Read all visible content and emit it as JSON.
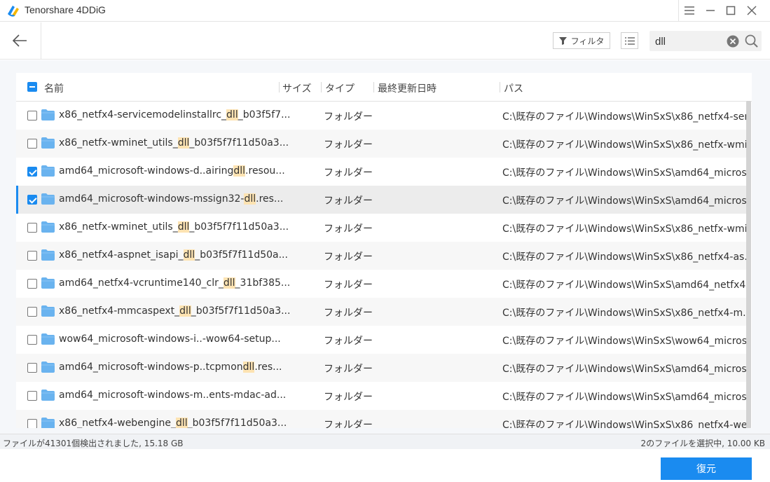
{
  "app": {
    "title": "Tenorshare 4DDiG"
  },
  "toolbar": {
    "filter_label": "フィルタ"
  },
  "search": {
    "value": "dll"
  },
  "table": {
    "columns": {
      "name": "名前",
      "size": "サイズ",
      "type": "タイプ",
      "modified": "最終更新日時",
      "path": "パス"
    },
    "rows": [
      {
        "name_pre": "x86_netfx4-servicemodelinstallrc_",
        "name_hl": "dll",
        "name_post": "_b03f5f7...",
        "type": "フォルダー",
        "path": "C:\\既存のファイル\\Windows\\WinSxS\\x86_netfx4-ser...",
        "checked": false
      },
      {
        "name_pre": "x86_netfx-wminet_utils_",
        "name_hl": "dll",
        "name_post": "_b03f5f7f11d50a3...",
        "type": "フォルダー",
        "path": "C:\\既存のファイル\\Windows\\WinSxS\\x86_netfx-wmi...",
        "checked": false
      },
      {
        "name_pre": "amd64_microsoft-windows-d..airing",
        "name_hl": "dll",
        "name_post": ".resou...",
        "type": "フォルダー",
        "path": "C:\\既存のファイル\\Windows\\WinSxS\\amd64_micros...",
        "checked": true
      },
      {
        "name_pre": "amd64_microsoft-windows-mssign32-",
        "name_hl": "dll",
        "name_post": ".res...",
        "type": "フォルダー",
        "path": "C:\\既存のファイル\\Windows\\WinSxS\\amd64_micros...",
        "checked": true
      },
      {
        "name_pre": "x86_netfx-wminet_utils_",
        "name_hl": "dll",
        "name_post": "_b03f5f7f11d50a3...",
        "type": "フォルダー",
        "path": "C:\\既存のファイル\\Windows\\WinSxS\\x86_netfx-wmi...",
        "checked": false
      },
      {
        "name_pre": "x86_netfx4-aspnet_isapi_",
        "name_hl": "dll",
        "name_post": "_b03f5f7f11d50a...",
        "type": "フォルダー",
        "path": "C:\\既存のファイル\\Windows\\WinSxS\\x86_netfx4-as...",
        "checked": false
      },
      {
        "name_pre": "amd64_netfx4-vcruntime140_clr_",
        "name_hl": "dll",
        "name_post": "_31bf385...",
        "type": "フォルダー",
        "path": "C:\\既存のファイル\\Windows\\WinSxS\\amd64_netfx4...",
        "checked": false
      },
      {
        "name_pre": "x86_netfx4-mmcaspext_",
        "name_hl": "dll",
        "name_post": "_b03f5f7f11d50a3...",
        "type": "フォルダー",
        "path": "C:\\既存のファイル\\Windows\\WinSxS\\x86_netfx4-m...",
        "checked": false
      },
      {
        "name_pre": "wow64_microsoft-windows-i..-wow64-setup...",
        "name_hl": "",
        "name_post": "",
        "type": "フォルダー",
        "path": "C:\\既存のファイル\\Windows\\WinSxS\\wow64_micros...",
        "checked": false
      },
      {
        "name_pre": "amd64_microsoft-windows-p..tcpmon",
        "name_hl": "dll",
        "name_post": ".res...",
        "type": "フォルダー",
        "path": "C:\\既存のファイル\\Windows\\WinSxS\\amd64_micros...",
        "checked": false
      },
      {
        "name_pre": "amd64_microsoft-windows-m..ents-mdac-ad...",
        "name_hl": "",
        "name_post": "",
        "type": "フォルダー",
        "path": "C:\\既存のファイル\\Windows\\WinSxS\\amd64_micros...",
        "checked": false
      },
      {
        "name_pre": "x86_netfx4-webengine_",
        "name_hl": "dll",
        "name_post": "_b03f5f7f11d50a3...",
        "type": "フォルダー",
        "path": "C:\\既存のファイル\\Windows\\WinSxS\\x86_netfx4-we...",
        "checked": false
      }
    ]
  },
  "status": {
    "found": "ファイルが41301個検出されました, 15.18 GB",
    "selected": "2のファイルを選択中, 10.00 KB"
  },
  "actions": {
    "recover_label": "復元"
  },
  "colors": {
    "accent": "#1a8bf0",
    "highlight": "#fde3b2",
    "folder": "#6ab3ef"
  }
}
